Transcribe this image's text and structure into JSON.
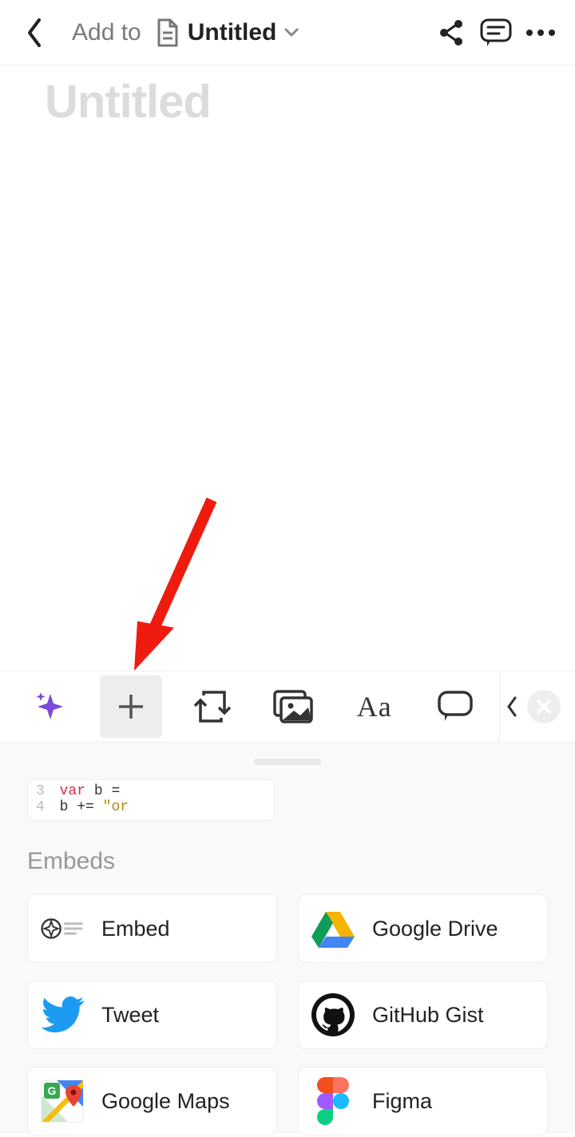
{
  "header": {
    "add_to": "Add to",
    "doc_title": "Untitled"
  },
  "editor": {
    "title_placeholder": "Untitled"
  },
  "toolbar": {
    "text_style_label": "Aa"
  },
  "sheet": {
    "code_snippet": {
      "line_a_num": "3",
      "line_a_kw": "var",
      "line_a_rest": "b =",
      "line_b_num": "4",
      "line_b_code": "b +=",
      "line_b_str": "\"or"
    },
    "section_title": "Embeds",
    "tiles": [
      {
        "label": "Embed"
      },
      {
        "label": "Google Drive"
      },
      {
        "label": "Tweet"
      },
      {
        "label": "GitHub Gist"
      },
      {
        "label": "Google Maps"
      },
      {
        "label": "Figma"
      }
    ]
  }
}
